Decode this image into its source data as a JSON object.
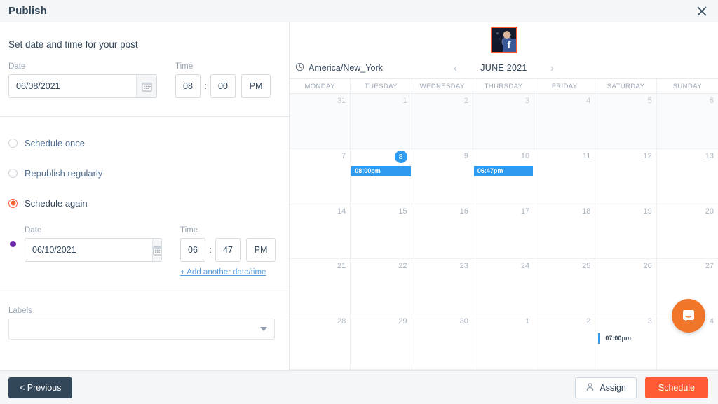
{
  "header": {
    "title": "Publish",
    "close_icon": "close-icon"
  },
  "left": {
    "section_title": "Set date and time for your post",
    "primary": {
      "date_label": "Date",
      "date_value": "06/08/2021",
      "date_placeholder": "mm/dd/yyyy",
      "calendar_icon": "calendar-icon",
      "time_label": "Time",
      "hour": "08",
      "separator": ":",
      "minute": "00",
      "meridiem": "PM"
    },
    "options": [
      {
        "label": "Schedule once",
        "selected": false
      },
      {
        "label": "Republish regularly",
        "selected": false
      },
      {
        "label": "Schedule again",
        "selected": true
      }
    ],
    "secondary": {
      "bullet_color": "#6a28a8",
      "date_label": "Date",
      "date_value": "06/10/2021",
      "date_placeholder": "mm/dd/yyyy",
      "calendar_icon": "calendar-icon",
      "time_label": "Time",
      "hour": "06",
      "separator": ":",
      "minute": "47",
      "meridiem": "PM",
      "add_link": "+ Add another date/time"
    },
    "labels": {
      "label": "Labels",
      "value": "",
      "placeholder": ""
    }
  },
  "calendar": {
    "account": {
      "network": "facebook",
      "badge_glyph": "f",
      "border_color": "#ff5c35"
    },
    "timezone_icon": "clock-icon",
    "timezone": "America/New_York",
    "prev_label": "‹",
    "next_label": "›",
    "month": "JUNE 2021",
    "weekdays": [
      "MONDAY",
      "TUESDAY",
      "WEDNESDAY",
      "THURSDAY",
      "FRIDAY",
      "SATURDAY",
      "SUNDAY"
    ],
    "accent_color": "#2e9bf0",
    "days": [
      {
        "num": "31",
        "other": true
      },
      {
        "num": "1",
        "other": true
      },
      {
        "num": "2",
        "other": true
      },
      {
        "num": "3",
        "other": true
      },
      {
        "num": "4",
        "other": true
      },
      {
        "num": "5",
        "other": true
      },
      {
        "num": "6",
        "other": true
      },
      {
        "num": "7",
        "other": false
      },
      {
        "num": "8",
        "other": false,
        "today": true,
        "event": "08:00pm",
        "event_style": "filled"
      },
      {
        "num": "9",
        "other": false
      },
      {
        "num": "10",
        "other": false,
        "event": "06:47pm",
        "event_style": "filled"
      },
      {
        "num": "11",
        "other": false
      },
      {
        "num": "12",
        "other": false
      },
      {
        "num": "13",
        "other": false
      },
      {
        "num": "14",
        "other": false
      },
      {
        "num": "15",
        "other": false
      },
      {
        "num": "16",
        "other": false
      },
      {
        "num": "17",
        "other": false
      },
      {
        "num": "18",
        "other": false
      },
      {
        "num": "19",
        "other": false
      },
      {
        "num": "20",
        "other": false
      },
      {
        "num": "21",
        "other": false
      },
      {
        "num": "22",
        "other": false
      },
      {
        "num": "23",
        "other": false
      },
      {
        "num": "24",
        "other": false
      },
      {
        "num": "25",
        "other": false
      },
      {
        "num": "26",
        "other": false
      },
      {
        "num": "27",
        "other": false
      },
      {
        "num": "28",
        "other": false
      },
      {
        "num": "29",
        "other": false
      },
      {
        "num": "30",
        "other": false
      },
      {
        "num": "1",
        "other": false
      },
      {
        "num": "2",
        "other": false
      },
      {
        "num": "3",
        "other": false,
        "event": "07:00pm",
        "event_style": "plain"
      },
      {
        "num": "4",
        "other": false
      }
    ]
  },
  "footer": {
    "previous": "< Previous",
    "assign": "Assign",
    "assign_icon": "person-icon",
    "schedule": "Schedule"
  },
  "intercom": {
    "icon": "chat-bubble-icon",
    "color": "#f2762a"
  }
}
